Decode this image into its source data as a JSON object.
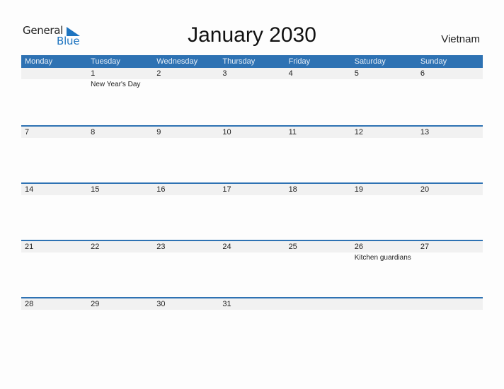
{
  "logo": {
    "word1": "General",
    "word2": "Blue",
    "accent_color": "#1e74c0"
  },
  "header": {
    "title": "January 2030",
    "country": "Vietnam"
  },
  "calendar": {
    "header_color": "#2e72b3",
    "weekdays": [
      "Monday",
      "Tuesday",
      "Wednesday",
      "Thursday",
      "Friday",
      "Saturday",
      "Sunday"
    ],
    "weeks": [
      [
        {
          "day": "",
          "event": ""
        },
        {
          "day": "1",
          "event": "New Year's Day"
        },
        {
          "day": "2",
          "event": ""
        },
        {
          "day": "3",
          "event": ""
        },
        {
          "day": "4",
          "event": ""
        },
        {
          "day": "5",
          "event": ""
        },
        {
          "day": "6",
          "event": ""
        }
      ],
      [
        {
          "day": "7",
          "event": ""
        },
        {
          "day": "8",
          "event": ""
        },
        {
          "day": "9",
          "event": ""
        },
        {
          "day": "10",
          "event": ""
        },
        {
          "day": "11",
          "event": ""
        },
        {
          "day": "12",
          "event": ""
        },
        {
          "day": "13",
          "event": ""
        }
      ],
      [
        {
          "day": "14",
          "event": ""
        },
        {
          "day": "15",
          "event": ""
        },
        {
          "day": "16",
          "event": ""
        },
        {
          "day": "17",
          "event": ""
        },
        {
          "day": "18",
          "event": ""
        },
        {
          "day": "19",
          "event": ""
        },
        {
          "day": "20",
          "event": ""
        }
      ],
      [
        {
          "day": "21",
          "event": ""
        },
        {
          "day": "22",
          "event": ""
        },
        {
          "day": "23",
          "event": ""
        },
        {
          "day": "24",
          "event": ""
        },
        {
          "day": "25",
          "event": ""
        },
        {
          "day": "26",
          "event": "Kitchen guardians"
        },
        {
          "day": "27",
          "event": ""
        }
      ],
      [
        {
          "day": "28",
          "event": ""
        },
        {
          "day": "29",
          "event": ""
        },
        {
          "day": "30",
          "event": ""
        },
        {
          "day": "31",
          "event": ""
        },
        {
          "day": "",
          "event": ""
        },
        {
          "day": "",
          "event": ""
        },
        {
          "day": "",
          "event": ""
        }
      ]
    ]
  }
}
